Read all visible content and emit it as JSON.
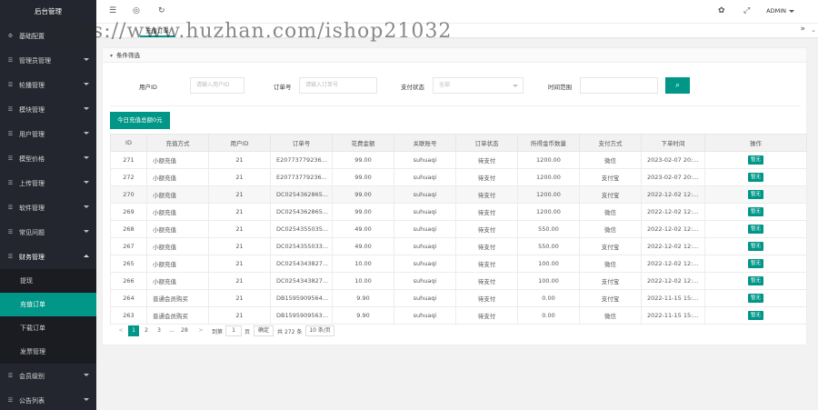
{
  "sidebar": {
    "brand": "后台管理",
    "items": [
      {
        "label": "基础配置",
        "icon": "gear-icon"
      },
      {
        "label": "管理员管理",
        "icon": "menu-icon"
      },
      {
        "label": "轮播管理",
        "icon": "menu-icon"
      },
      {
        "label": "模块管理",
        "icon": "menu-icon"
      },
      {
        "label": "用户管理",
        "icon": "menu-icon"
      },
      {
        "label": "模型价格",
        "icon": "menu-icon"
      },
      {
        "label": "上传管理",
        "icon": "menu-icon"
      },
      {
        "label": "软件管理",
        "icon": "menu-icon"
      },
      {
        "label": "常见问题",
        "icon": "menu-icon"
      },
      {
        "label": "财务管理",
        "icon": "menu-icon"
      }
    ],
    "finance_sub": [
      "提现",
      "充值订单",
      "下载订单",
      "发票管理"
    ],
    "bottom_items": [
      {
        "label": "会员级别",
        "icon": "menu-icon"
      },
      {
        "label": "公告列表",
        "icon": "menu-icon"
      }
    ]
  },
  "header": {
    "admin_label": "ADMIN",
    "tab_label": "充值订单",
    "icons": [
      "menu-icon",
      "globe-icon",
      "refresh-icon",
      "theme-icon",
      "fullscreen-icon"
    ]
  },
  "watermark": "https://www.huzhan.com/ishop21032",
  "filter": {
    "section_title": "条件筛选",
    "user_id_label": "用户ID",
    "user_id_placeholder": "请输入用户ID",
    "order_no_label": "订单号",
    "order_no_placeholder": "请输入订单号",
    "pay_status_label": "支付状态",
    "pay_status_value": "全部",
    "time_label": "时间范围"
  },
  "today_button": "今日充值总额0元",
  "table": {
    "headers": [
      "ID",
      "充值方式",
      "用户ID",
      "订单号",
      "花费金额",
      "关联账号",
      "订单状态",
      "所得金币数量",
      "支付方式",
      "下单时间",
      "操作"
    ],
    "rows": [
      [
        "271",
        "小额充值",
        "21",
        "E20773779236...",
        "99.00",
        "suhuaqi",
        "待支付",
        "1200.00",
        "微信",
        "2023-02-07 20:...",
        "暂无"
      ],
      [
        "272",
        "小额充值",
        "21",
        "E20773779236...",
        "99.00",
        "suhuaqi",
        "待支付",
        "1200.00",
        "支付宝",
        "2023-02-07 20:...",
        "暂无"
      ],
      [
        "270",
        "小额充值",
        "21",
        "DC0254362865...",
        "99.00",
        "suhuaqi",
        "待支付",
        "1200.00",
        "支付宝",
        "2022-12-02 12:...",
        "暂无"
      ],
      [
        "269",
        "小额充值",
        "21",
        "DC0254362865...",
        "99.00",
        "suhuaqi",
        "待支付",
        "1200.00",
        "微信",
        "2022-12-02 12:...",
        "暂无"
      ],
      [
        "268",
        "小额充值",
        "21",
        "DC0254355035...",
        "49.00",
        "suhuaqi",
        "待支付",
        "550.00",
        "微信",
        "2022-12-02 12:...",
        "暂无"
      ],
      [
        "267",
        "小额充值",
        "21",
        "DC0254355033...",
        "49.00",
        "suhuaqi",
        "待支付",
        "550.00",
        "支付宝",
        "2022-12-02 12:...",
        "暂无"
      ],
      [
        "265",
        "小额充值",
        "21",
        "DC0254343827...",
        "10.00",
        "suhuaqi",
        "待支付",
        "100.00",
        "微信",
        "2022-12-02 12:...",
        "暂无"
      ],
      [
        "266",
        "小额充值",
        "21",
        "DC0254343827...",
        "10.00",
        "suhuaqi",
        "待支付",
        "100.00",
        "支付宝",
        "2022-12-02 12:...",
        "暂无"
      ],
      [
        "264",
        "普通会员购买",
        "21",
        "DB1595909564...",
        "9.90",
        "suhuaqi",
        "待支付",
        "0.00",
        "支付宝",
        "2022-11-15 15:...",
        "暂无"
      ],
      [
        "263",
        "普通会员购买",
        "21",
        "DB1595909563...",
        "9.90",
        "suhuaqi",
        "待支付",
        "0.00",
        "微信",
        "2022-11-15 15:...",
        "暂无"
      ]
    ]
  },
  "pager": {
    "prev": "<",
    "pages": [
      "1",
      "2",
      "3",
      "...",
      "28"
    ],
    "next": ">",
    "goto_label": "到第",
    "goto_value": "1",
    "page_unit": "页",
    "confirm": "确定",
    "total": "共 272 条",
    "per_page": "10 条/页"
  },
  "colors": {
    "accent": "#009688",
    "sidebar": "#23262e"
  }
}
